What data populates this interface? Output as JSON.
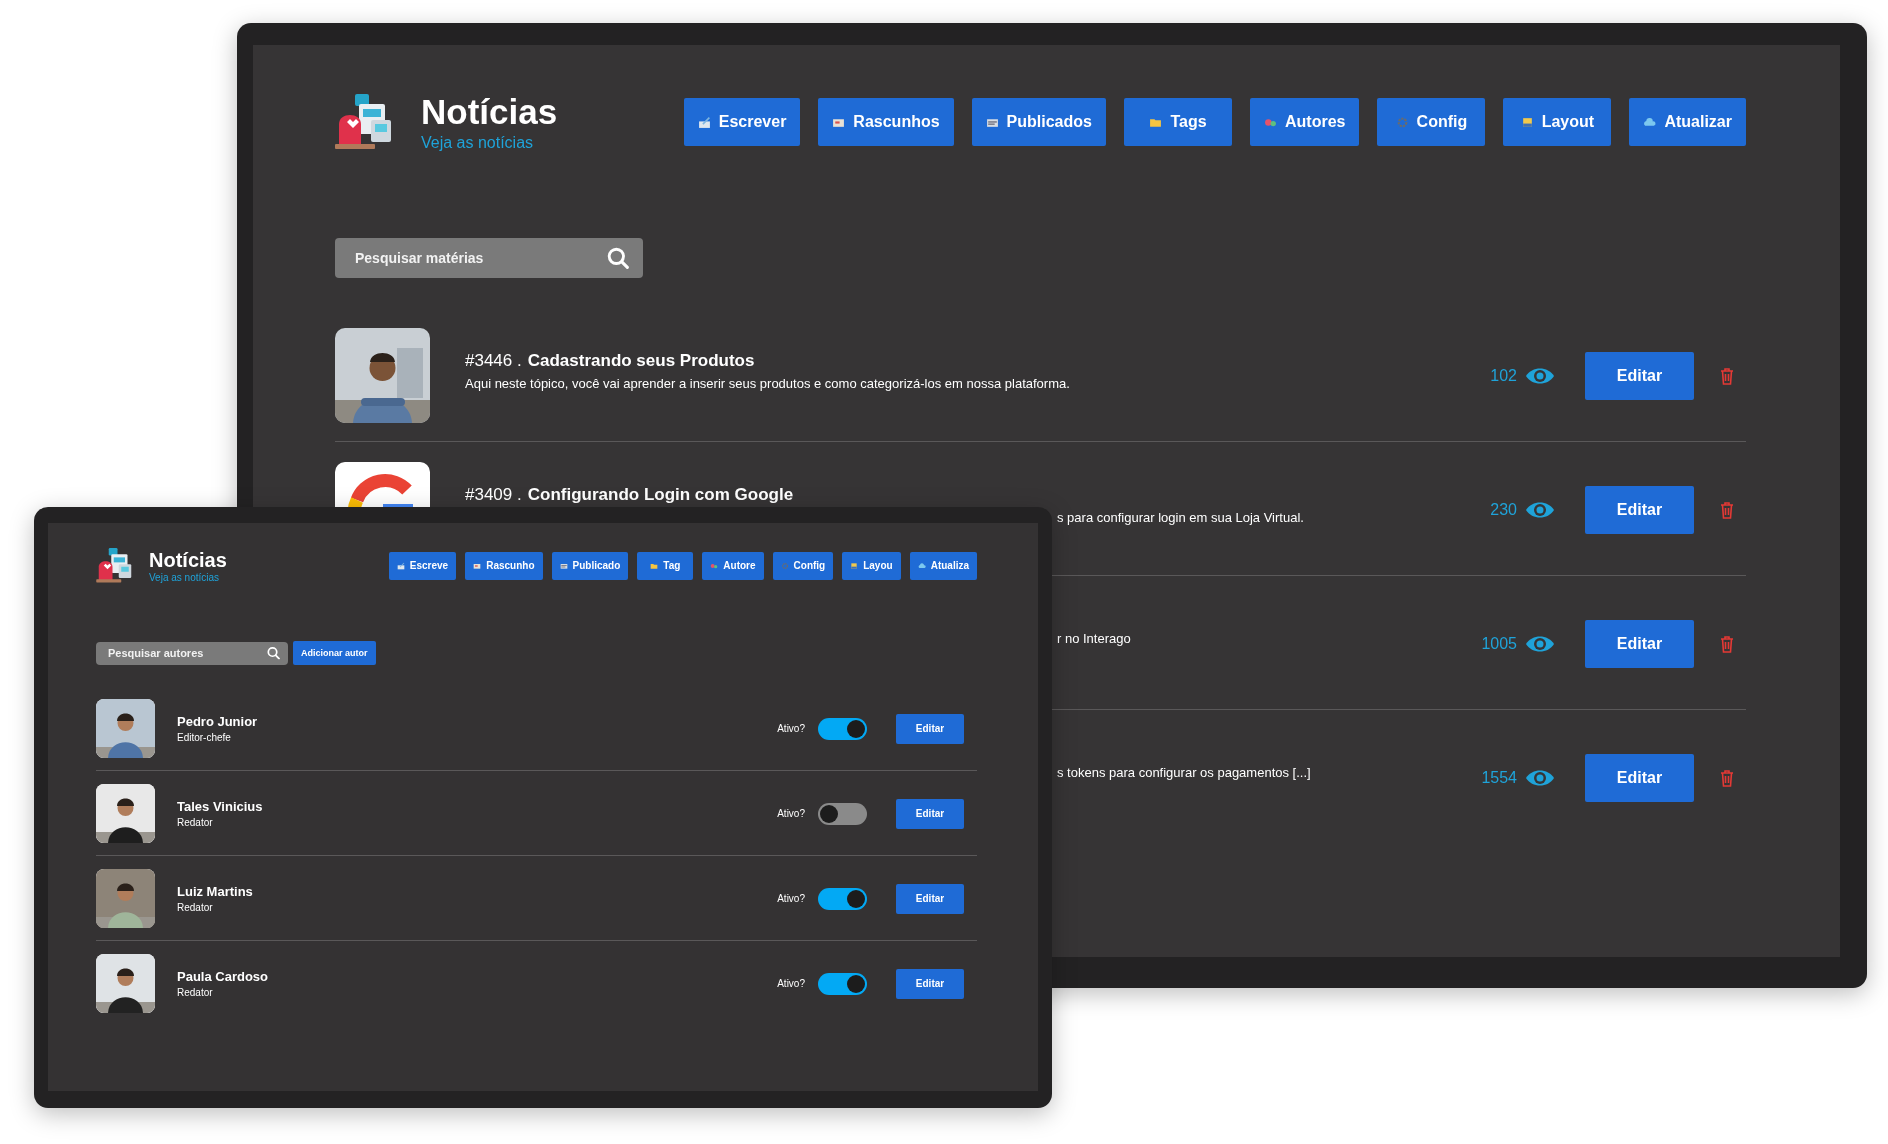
{
  "windows": [
    {
      "kind": "posts",
      "title": "Notícias",
      "subtitle": "Veja as notícias",
      "nav": [
        "Escrever",
        "Rascunhos",
        "Publicados",
        "Tags",
        "Autores",
        "Config",
        "Layout",
        "Atualizar"
      ],
      "search": {
        "placeholder": "Pesquisar matérias"
      },
      "posts": [
        {
          "id": "#3446 .",
          "title": "Cadastrando seus Produtos",
          "description": "Aqui neste tópico, você vai aprender a inserir seus produtos e como categorizá-los em nossa plataforma.",
          "covered": false,
          "views": "102",
          "edit": "Editar"
        },
        {
          "thumbnail": {
            "kind": "logo"
          },
          "id": "#3409 .",
          "title": "Configurando Login com Google",
          "description": "s para configurar login em sua Loja Virtual.",
          "covered": true,
          "views": "230",
          "edit": "Editar"
        },
        {
          "description": "r no Interago",
          "covered": true,
          "views": "1005",
          "edit": "Editar"
        },
        {
          "description": "s tokens para configurar os pagamentos [...]",
          "covered": true,
          "views": "1554",
          "edit": "Editar"
        }
      ]
    },
    {
      "kind": "authors",
      "title": "Notícias",
      "subtitle": "Veja as notícias",
      "nav": [
        "Escreve",
        "Rascunho",
        "Publicado",
        "Tag",
        "Autore",
        "Config",
        "Layou",
        "Atualiza"
      ],
      "search": {
        "placeholder": "Pesquisar autores"
      },
      "add_button": "Adicionar autor",
      "authors": [
        {
          "name": "Pedro Junior",
          "role": "Editor-chefe",
          "active_label": "Ativo?",
          "active": true,
          "edit": "Editar"
        },
        {
          "name": "Tales Vinicius",
          "role": "Redator",
          "active_label": "Ativo?",
          "active": false,
          "edit": "Editar"
        },
        {
          "name": "Luiz Martins",
          "role": "Redator",
          "active_label": "Ativo?",
          "active": true,
          "edit": "Editar"
        },
        {
          "name": "Paula Cardoso",
          "role": "Redator",
          "active_label": "Ativo?",
          "active": true,
          "edit": "Editar"
        }
      ]
    }
  ]
}
